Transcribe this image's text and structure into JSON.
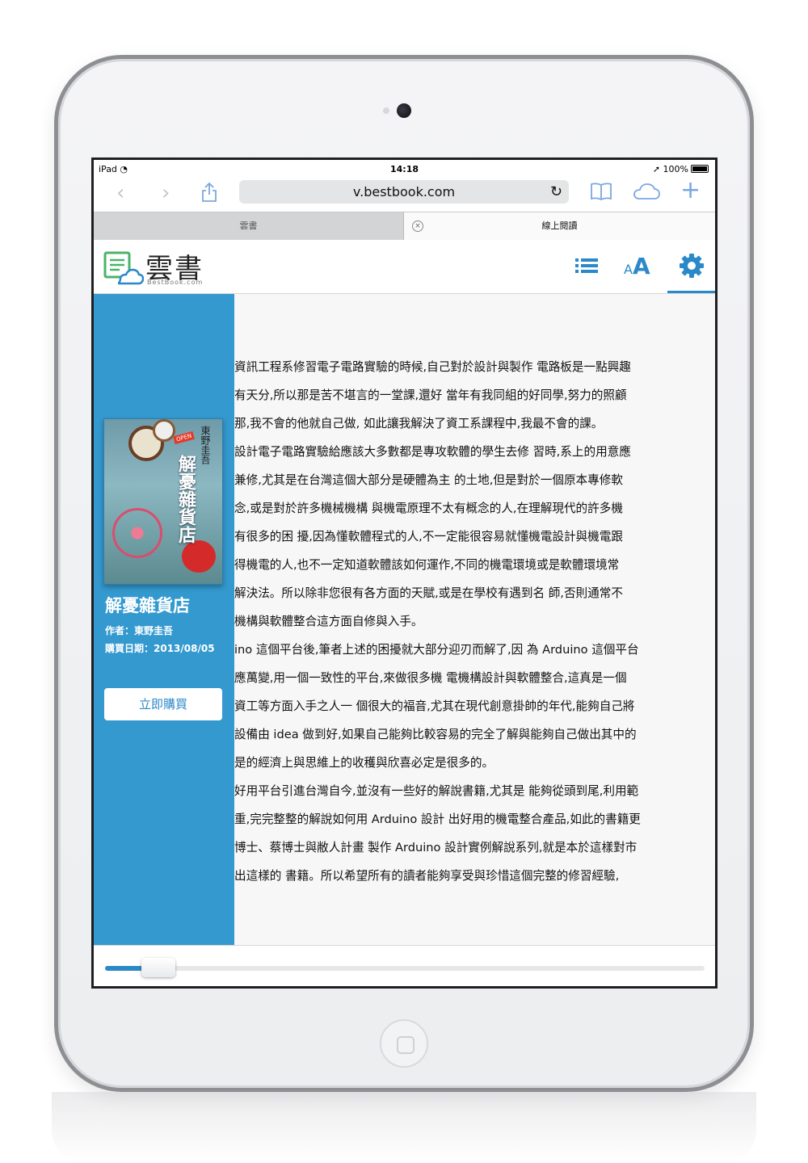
{
  "status_bar": {
    "carrier": "iPad",
    "time": "14:18",
    "battery": "100%"
  },
  "browser": {
    "url": "v.bestbook.com",
    "tabs": [
      {
        "label": "雲書"
      },
      {
        "label": "線上閱讀"
      }
    ]
  },
  "app": {
    "logo_text": "雲書",
    "logo_sub": "BestBook.com"
  },
  "book": {
    "cover_title": "解憂雜貨店",
    "cover_author": "東野圭吾",
    "cover_badge": "OPEN",
    "title": "解憂雜貨店",
    "author": "作者：東野圭吾",
    "purchase_date": "購買日期：2013/08/05",
    "buy_label": "立即購買"
  },
  "reader": {
    "paragraphs": [
      "資訊工程系修習電子電路實驗的時候,自己對於設計與製作 電路板是一點興趣",
      "有天分,所以那是苦不堪言的一堂課,還好 當年有我同組的好同學,努力的照顧",
      "那,我不會的他就自己做, 如此讓我解決了資工系課程中,我最不會的課。",
      "設計電子電路實驗給應該大多數都是專攻軟體的學生去修 習時,系上的用意應",
      "兼修,尤其是在台灣這個大部分是硬體為主 的土地,但是對於一個原本專修軟",
      "念,或是對於許多機械機構 與機電原理不太有概念的人,在理解現代的許多機",
      "有很多的困 擾,因為懂軟體程式的人,不一定能很容易就懂機電設計與機電跟",
      "得機電的人,也不一定知道軟體該如何運作,不同的機電環境或是軟體環境常",
      "解決法。所以除非您很有各方面的天賦,或是在學校有遇到名 師,否則通常不",
      "機構與軟體整合這方面自修與入手。",
      "ino 這個平台後,筆者上述的困擾就大部分迎刃而解了,因 為 Arduino 這個平台",
      "應萬變,用一個一致性的平台,來做很多機 電機構設計與軟體整合,這真是一個",
      "資工等方面入手之人一 個很大的福音,尤其在現代創意掛帥的年代,能夠自己將",
      "設備由 idea 做到好,如果自己能夠比較容易的完全了解與能夠自己做出其中的",
      "是的經濟上與思維上的收穫與欣喜必定是很多的。",
      "好用平台引進台灣自今,並沒有一些好的解說書籍,尤其是 能夠從頭到尾,利用範",
      "重,完完整整的解說如何用 Arduino 設計 出好用的機電整合產品,如此的書籍更",
      "博士、蔡博士與敝人計畫 製作 Arduino 設計實例解說系列,就是本於這樣對市",
      "出這樣的 書籍。所以希望所有的讀者能夠享受與珍惜這個完整的修習經驗,"
    ],
    "progress": 0.08
  },
  "icons": {
    "back": "chevron-left-icon",
    "forward": "chevron-right-icon",
    "share": "share-icon",
    "reload": "reload-icon",
    "bookmarks": "book-icon",
    "icloud": "cloud-icon",
    "new_tab": "plus-icon",
    "toc": "list-icon",
    "font_size": "font-size-icon",
    "settings": "gear-icon"
  },
  "colors": {
    "accent": "#2b89c9",
    "sidebar": "#3499cf"
  }
}
